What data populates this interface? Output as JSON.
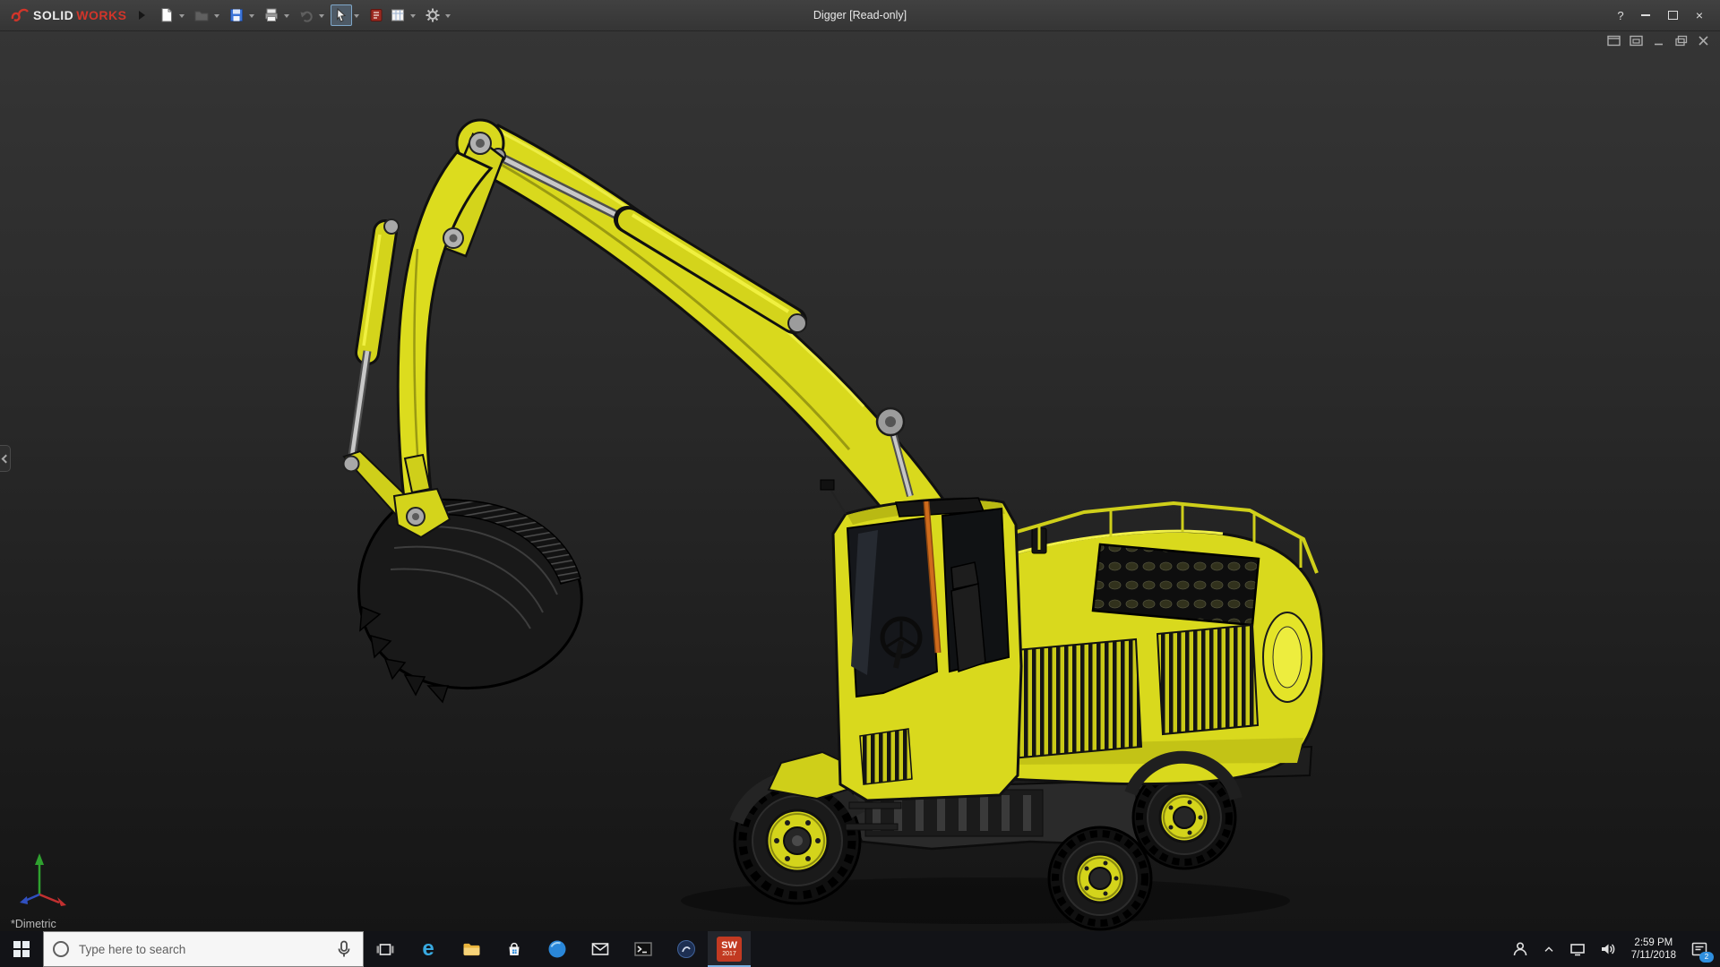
{
  "titlebar": {
    "brand_solid": "SOLID",
    "brand_works": "WORKS",
    "title": "Digger [Read-only]",
    "help": "?",
    "close_glyph": "×",
    "toolbar_buttons": [
      "new-document",
      "open",
      "save",
      "print",
      "undo",
      "select",
      "design-library",
      "evaluate-sheet",
      "options"
    ]
  },
  "viewport": {
    "view_label": "*Dimetric",
    "doc_window_controls": [
      "float-window",
      "dock-window",
      "minimize-doc",
      "restore-doc",
      "close-doc"
    ],
    "model_parts": [
      "bucket",
      "boom",
      "stick-arm",
      "boom-cylinder",
      "bucket-cylinder",
      "cab",
      "engine-housing",
      "chassis",
      "wheels"
    ]
  },
  "taskbar": {
    "search_placeholder": "Type here to search",
    "edge_glyph": "e",
    "sw": {
      "label": "SW",
      "year": "2017"
    },
    "clock": {
      "time": "2:59 PM",
      "date": "7/11/2018"
    },
    "notification_badge": "2",
    "icons": [
      "start",
      "cortana-search",
      "task-view",
      "edge",
      "file-explorer",
      "store",
      "blue-circle-app",
      "mail",
      "terminal",
      "dark-circle-app",
      "solidworks-2017",
      "people",
      "tray-expand",
      "network",
      "volume",
      "clock",
      "action-center"
    ]
  },
  "palette": {
    "excavator_yellow": "#d9d91d",
    "titlebar_bg": "#3a3a3a",
    "viewport_bg_top": "#353535",
    "viewport_bg_bottom": "#151515",
    "taskbar_bg": "#121317",
    "accent_blue": "#2f8fdf",
    "brand_red": "#d2352a"
  }
}
